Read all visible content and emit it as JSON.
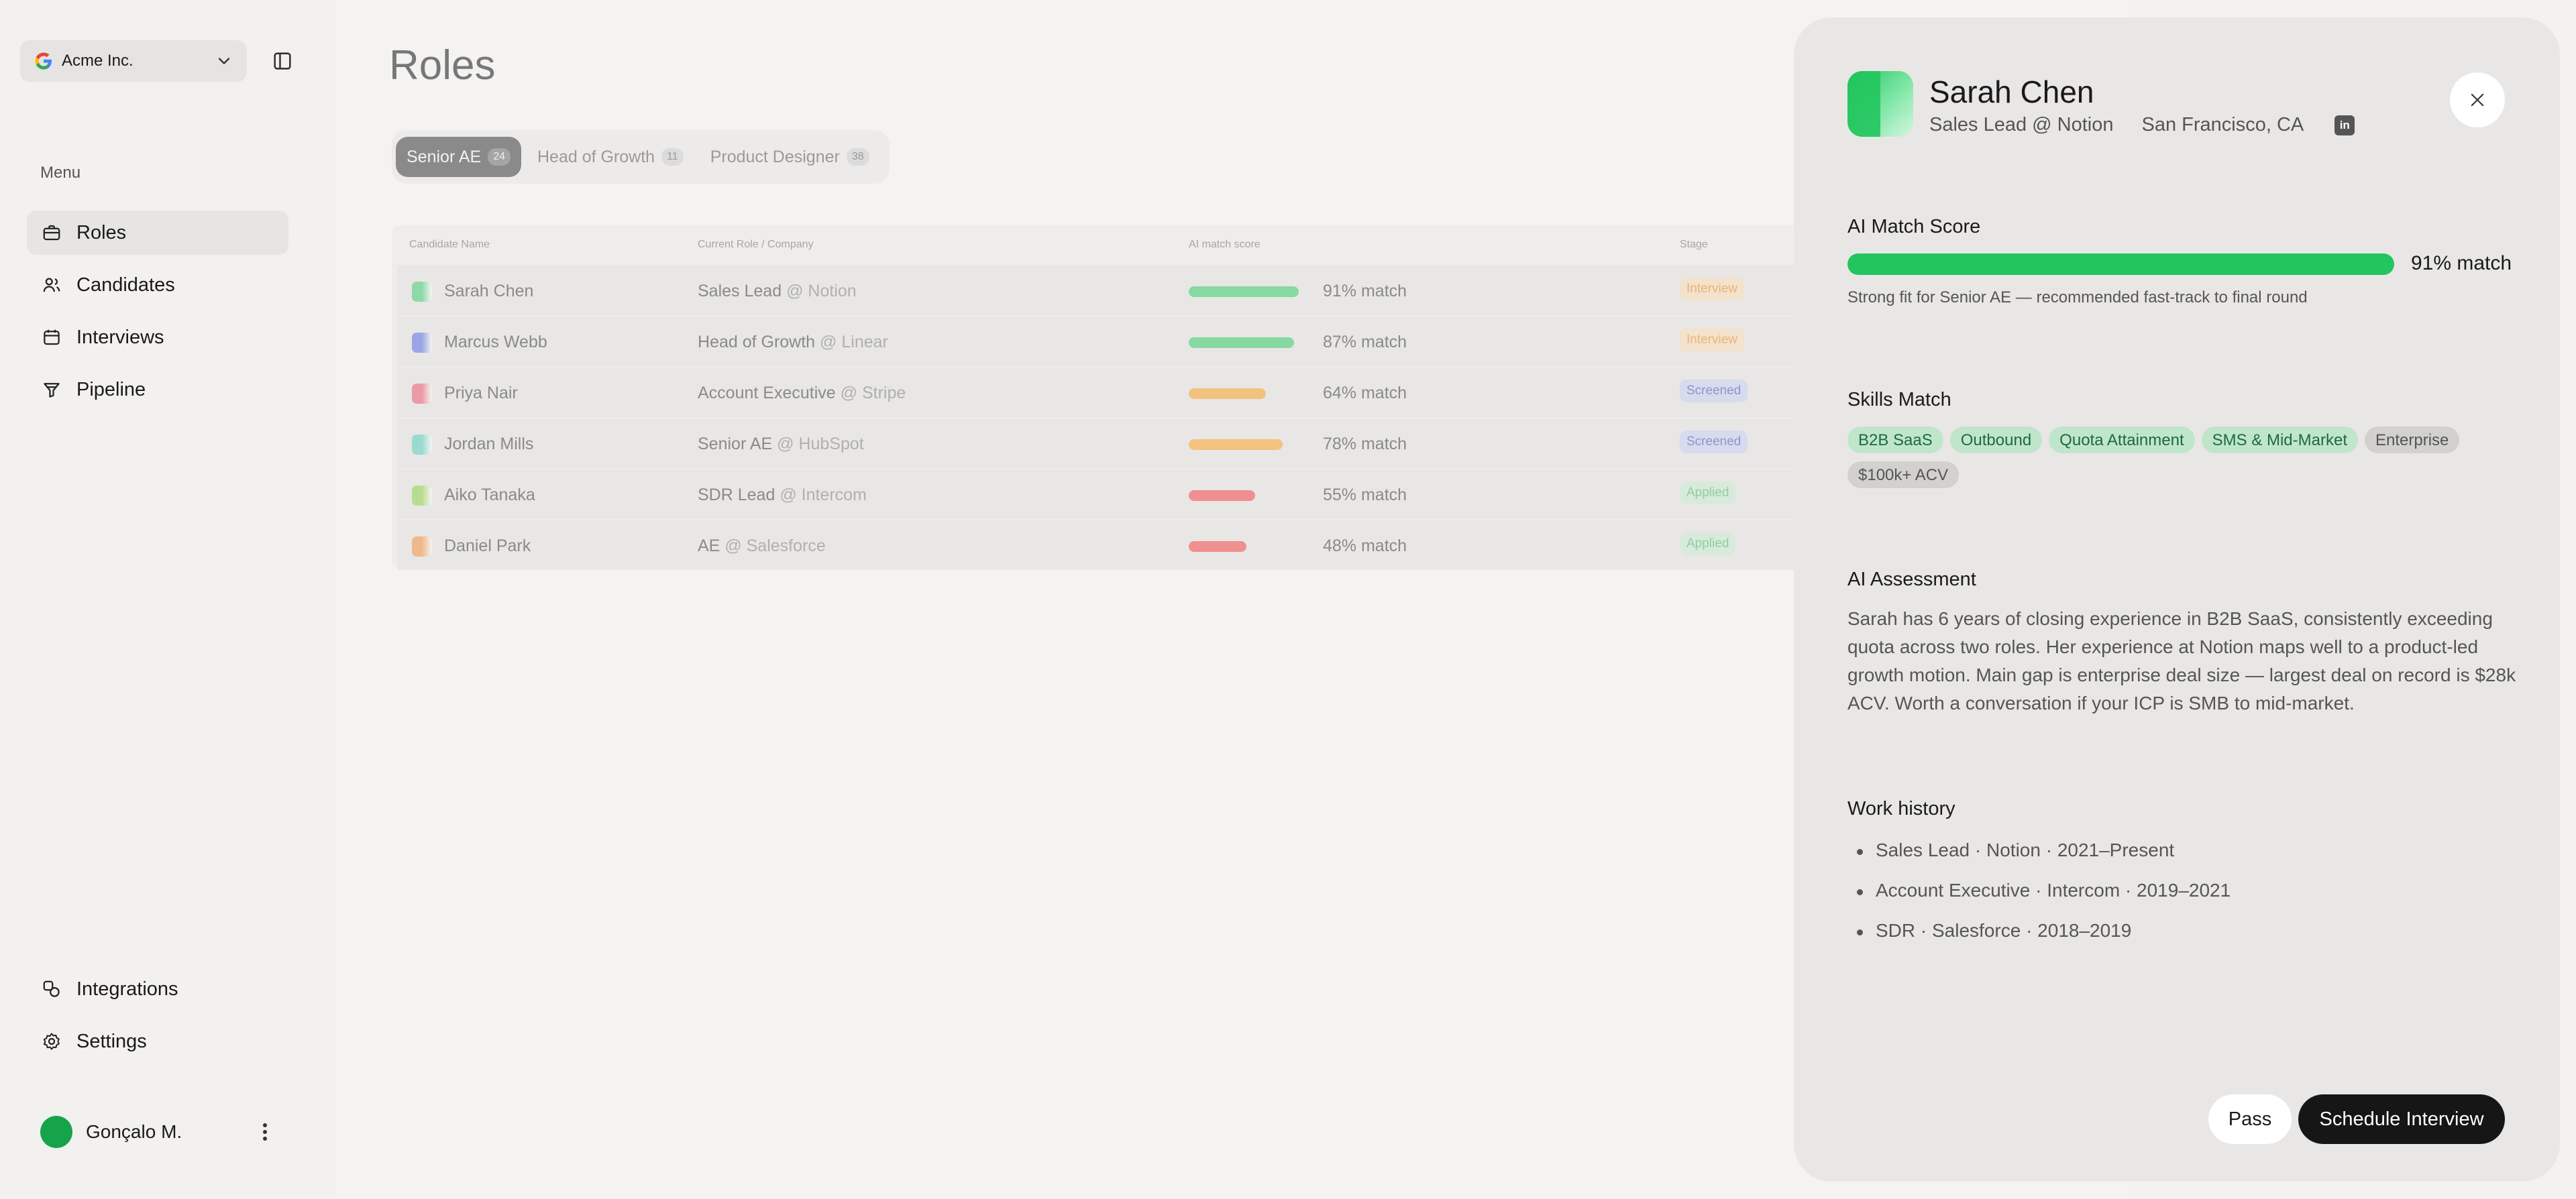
{
  "org": {
    "name": "Acme Inc."
  },
  "sidebar": {
    "menu_label": "Menu",
    "items": [
      {
        "label": "Roles",
        "icon": "briefcase-icon"
      },
      {
        "label": "Candidates",
        "icon": "users-icon"
      },
      {
        "label": "Interviews",
        "icon": "calendar-icon"
      },
      {
        "label": "Pipeline",
        "icon": "funnel-icon"
      }
    ],
    "bottom_items": [
      {
        "label": "Integrations",
        "icon": "integrations-icon"
      },
      {
        "label": "Settings",
        "icon": "gear-icon"
      }
    ],
    "user": {
      "name": "Gonçalo M."
    }
  },
  "main": {
    "title": "Roles",
    "tabs": [
      {
        "label": "Senior AE",
        "count": "24"
      },
      {
        "label": "Head of Growth",
        "count": "11"
      },
      {
        "label": "Product Designer",
        "count": "38"
      }
    ],
    "table": {
      "headers": [
        "Candidate Name",
        "Current Role / Company",
        "AI match score",
        "Stage"
      ],
      "rows": [
        {
          "name": "Sarah Chen",
          "role": "Sales Lead",
          "company": "@ Notion",
          "score": "91% match",
          "match": 91,
          "stage": "Interview",
          "stage_type": "interview",
          "bar_color": "#86d9a0",
          "icon_color": "#8fd9a8"
        },
        {
          "name": "Marcus Webb",
          "role": "Head of Growth",
          "company": "@ Linear",
          "score": "87% match",
          "match": 87,
          "stage": "Interview",
          "stage_type": "interview",
          "bar_color": "#86d9a0",
          "icon_color": "#9aa6e3"
        },
        {
          "name": "Priya Nair",
          "role": "Account Executive",
          "company": "@ Stripe",
          "score": "64% match",
          "match": 64,
          "stage": "Screened",
          "stage_type": "screened",
          "bar_color": "#f2c27e",
          "icon_color": "#ec9aa6"
        },
        {
          "name": "Jordan Mills",
          "role": "Senior AE",
          "company": "@ HubSpot",
          "score": "78% match",
          "match": 78,
          "stage": "Screened",
          "stage_type": "screened",
          "bar_color": "#f2c27e",
          "icon_color": "#9bdad0"
        },
        {
          "name": "Aiko Tanaka",
          "role": "SDR Lead",
          "company": "@ Intercom",
          "score": "55% match",
          "match": 55,
          "stage": "Applied",
          "stage_type": "applied",
          "bar_color": "#ef8f8f",
          "icon_color": "#b9dd8e"
        },
        {
          "name": "Daniel Park",
          "role": "AE",
          "company": "@ Salesforce",
          "score": "48% match",
          "match": 48,
          "stage": "Applied",
          "stage_type": "applied",
          "bar_color": "#ef8f8f",
          "icon_color": "#f0b98c"
        }
      ]
    }
  },
  "drawer": {
    "name": "Sarah Chen",
    "subtitle": "Sales Lead @ Notion",
    "location": "San Francisco, CA",
    "linkedin_label": "in",
    "match_title": "AI Match Score",
    "match_value": "91% match",
    "match_percent": 91,
    "match_note": "Strong fit for Senior AE — recommended fast-track to final round",
    "skills_title": "Skills Match",
    "skills": [
      {
        "label": "B2B SaaS",
        "matched": true
      },
      {
        "label": "Outbound",
        "matched": true
      },
      {
        "label": "Quota Attainment",
        "matched": true
      },
      {
        "label": "SMS & Mid-Market",
        "matched": true
      },
      {
        "label": "Enterprise",
        "matched": false
      },
      {
        "label": "$100k+ ACV",
        "matched": false
      }
    ],
    "assessment_title": "AI Assessment",
    "assessment": "Sarah has 6 years of closing experience in B2B SaaS, consistently exceeding quota across two roles. Her experience at Notion maps well to a product-led growth motion. Main gap is enterprise deal size — largest deal on record is $28k ACV. Worth a conversation if your ICP is SMB to mid-market.",
    "work_title": "Work history",
    "work": [
      "Sales Lead · Notion · 2021–Present",
      "Account Executive · Intercom · 2019–2021",
      "SDR · Salesforce · 2018–2019"
    ],
    "pass_label": "Pass",
    "schedule_label": "Schedule Interview"
  },
  "colors": {
    "accent_green": "#22c55e",
    "primary_button": "#161616"
  }
}
